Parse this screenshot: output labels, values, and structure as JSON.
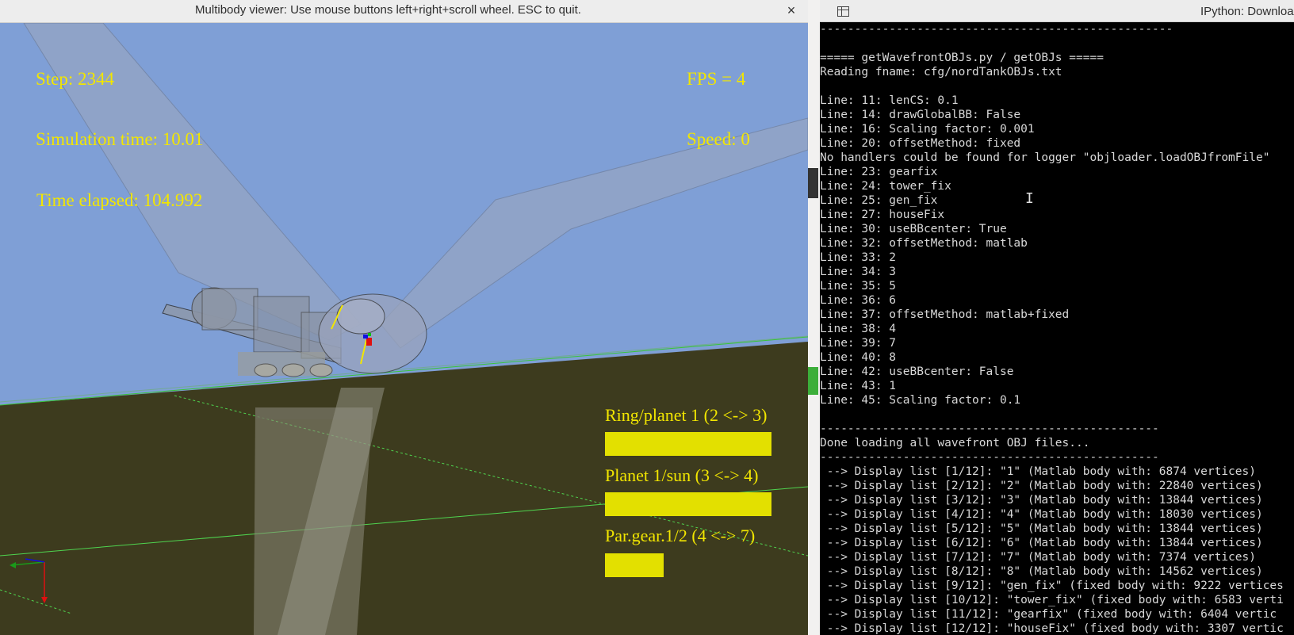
{
  "viewer": {
    "title": "Multibody viewer: Use mouse buttons left+right+scroll wheel. ESC to quit.",
    "close_glyph": "×",
    "hud": {
      "step": "Step: 2344",
      "sim_time": "Simulation time: 10.01",
      "time_elapsed": "Time elapsed: 104.992",
      "fps": "FPS = 4",
      "speed": "Speed: 0"
    },
    "gear_bars": [
      {
        "label": "Ring/planet 1 (2 <-> 3)",
        "fill_fraction": 1.0
      },
      {
        "label": "Planet 1/sun (3 <-> 4)",
        "fill_fraction": 1.0
      },
      {
        "label": "Par.gear.1/2 (4 <-> 7)",
        "fill_fraction": 0.35
      }
    ],
    "colors": {
      "sky": "#7f9fd6",
      "ground": "#3d3b1e",
      "hud_text": "#f2e600",
      "bar": "#e3e000"
    },
    "icons": [
      "close-icon",
      "axis-triad-icon"
    ]
  },
  "terminal": {
    "title": "IPython: Downloads/lo",
    "icons": [
      "terminal-menu-icon",
      "text-cursor-icon"
    ],
    "lines": [
      "---------------------------------------------------",
      "",
      "===== getWavefrontOBJs.py / getOBJs =====",
      "Reading fname: cfg/nordTankOBJs.txt",
      "",
      "Line: 11: lenCS: 0.1",
      "Line: 14: drawGlobalBB: False",
      "Line: 16: Scaling factor: 0.001",
      "Line: 20: offsetMethod: fixed",
      "No handlers could be found for logger \"objloader.loadOBJfromFile\"",
      "Line: 23: gearfix",
      "Line: 24: tower_fix",
      "Line: 25: gen_fix",
      "Line: 27: houseFix",
      "Line: 30: useBBcenter: True",
      "Line: 32: offsetMethod: matlab",
      "Line: 33: 2",
      "Line: 34: 3",
      "Line: 35: 5",
      "Line: 36: 6",
      "Line: 37: offsetMethod: matlab+fixed",
      "Line: 38: 4",
      "Line: 39: 7",
      "Line: 40: 8",
      "Line: 42: useBBcenter: False",
      "Line: 43: 1",
      "Line: 45: Scaling factor: 0.1",
      "",
      "-------------------------------------------------",
      "Done loading all wavefront OBJ files...",
      "-------------------------------------------------",
      " --> Display list [1/12]: \"1\" (Matlab body with: 6874 vertices)",
      " --> Display list [2/12]: \"2\" (Matlab body with: 22840 vertices)",
      " --> Display list [3/12]: \"3\" (Matlab body with: 13844 vertices)",
      " --> Display list [4/12]: \"4\" (Matlab body with: 18030 vertices)",
      " --> Display list [5/12]: \"5\" (Matlab body with: 13844 vertices)",
      " --> Display list [6/12]: \"6\" (Matlab body with: 13844 vertices)",
      " --> Display list [7/12]: \"7\" (Matlab body with: 7374 vertices)",
      " --> Display list [8/12]: \"8\" (Matlab body with: 14562 vertices)",
      " --> Display list [9/12]: \"gen_fix\" (fixed body with: 9222 vertices",
      " --> Display list [10/12]: \"tower_fix\" (fixed body with: 6583 verti",
      " --> Display list [11/12]: \"gearfix\" (fixed body with: 6404 vertic",
      " --> Display list [12/12]: \"houseFix\" (fixed body with: 3307 vertic"
    ],
    "cursor_glyph": "I"
  }
}
